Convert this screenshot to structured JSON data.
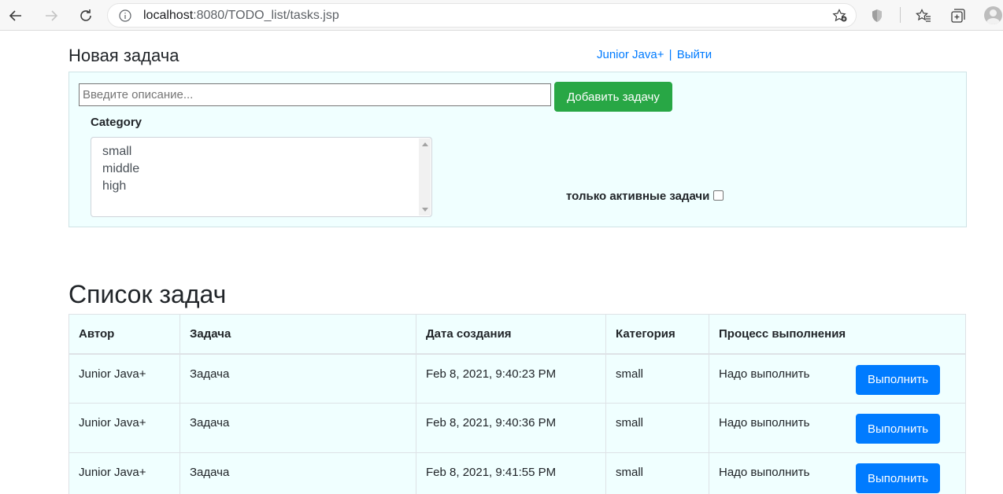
{
  "browser": {
    "url_host": "localhost",
    "url_rest": ":8080/TODO_list/tasks.jsp"
  },
  "header": {
    "new_task_title": "Новая задача",
    "user_name": "Junior Java+",
    "separator": "|",
    "logout": "Выйти"
  },
  "form": {
    "description_placeholder": "Введите описание...",
    "add_button": "Добавить задачу",
    "category_label": "Category",
    "categories": [
      "small",
      "middle",
      "high"
    ],
    "active_only_label": "только активные задачи",
    "active_only_checked": false
  },
  "list": {
    "title": "Список задач",
    "columns": [
      "Автор",
      "Задача",
      "Дата создания",
      "Категория",
      "Процесс выполнения"
    ],
    "rows": [
      {
        "author": "Junior Java+",
        "task": "Задача",
        "created": "Feb 8, 2021, 9:40:23 PM",
        "category": "small",
        "status": "Надо выполнить",
        "action": "Выполнить"
      },
      {
        "author": "Junior Java+",
        "task": "Задача",
        "created": "Feb 8, 2021, 9:40:36 PM",
        "category": "small",
        "status": "Надо выполнить",
        "action": "Выполнить"
      },
      {
        "author": "Junior Java+",
        "task": "Задача",
        "created": "Feb 8, 2021, 9:41:55 PM",
        "category": "small",
        "status": "Надо выполнить",
        "action": "Выполнить"
      }
    ]
  },
  "colors": {
    "panel_bg": "#f0ffff",
    "primary": "#007bff",
    "success": "#28a745"
  }
}
